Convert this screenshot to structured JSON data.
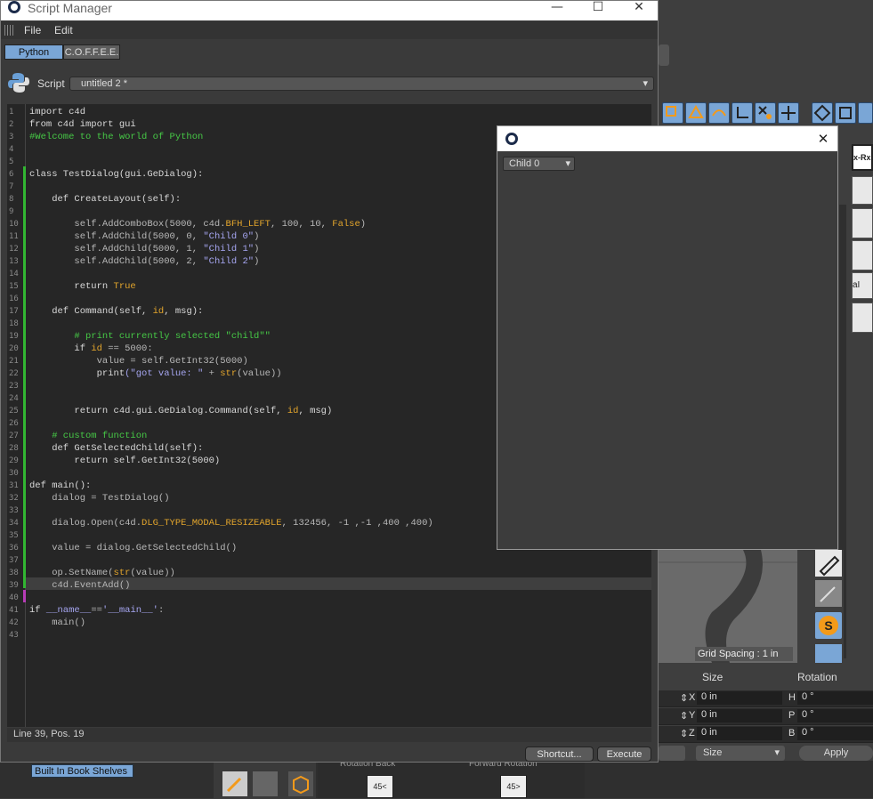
{
  "window": {
    "title": "Script Manager",
    "minimize": "—",
    "maximize": "☐",
    "close": "✕"
  },
  "menu": {
    "items": [
      "File",
      "Edit"
    ]
  },
  "language_tabs": [
    "Python",
    "C.O.F.F.E.E."
  ],
  "script_selector": {
    "label": "Script",
    "value": "untitled 2 *"
  },
  "editor": {
    "line_numbers": [
      "1",
      "2",
      "3",
      "4",
      "5",
      "6",
      "7",
      "8",
      "9",
      "10",
      "11",
      "12",
      "13",
      "14",
      "15",
      "16",
      "17",
      "18",
      "19",
      "20",
      "21",
      "22",
      "23",
      "24",
      "25",
      "26",
      "27",
      "28",
      "29",
      "30",
      "31",
      "32",
      "33",
      "34",
      "35",
      "36",
      "37",
      "38",
      "39",
      "40",
      "41",
      "42",
      "43"
    ],
    "lines": [
      [
        {
          "t": "import c4d",
          "c": "kw"
        }
      ],
      [
        {
          "t": "from c4d import gui",
          "c": "kw"
        }
      ],
      [
        {
          "t": "#Welcome to the world of Python",
          "c": "cmt"
        }
      ],
      [],
      [],
      [
        {
          "t": "class TestDialog(gui.GeDialog):",
          "c": "kw"
        }
      ],
      [],
      [
        {
          "t": "    def CreateLayout(self):",
          "c": "kw"
        }
      ],
      [],
      [
        {
          "t": "        self.AddComboBox(5000, c4d.",
          "c": "fn"
        },
        {
          "t": "BFH_LEFT",
          "c": "cst"
        },
        {
          "t": ", 100, 10, ",
          "c": "fn"
        },
        {
          "t": "False",
          "c": "cst"
        },
        {
          "t": ")",
          "c": "fn"
        }
      ],
      [
        {
          "t": "        self.AddChild(5000, 0, ",
          "c": "fn"
        },
        {
          "t": "\"Child 0\"",
          "c": "str"
        },
        {
          "t": ")",
          "c": "fn"
        }
      ],
      [
        {
          "t": "        self.AddChild(5000, 1, ",
          "c": "fn"
        },
        {
          "t": "\"Child 1\"",
          "c": "str"
        },
        {
          "t": ")",
          "c": "fn"
        }
      ],
      [
        {
          "t": "        self.AddChild(5000, 2, ",
          "c": "fn"
        },
        {
          "t": "\"Child 2\"",
          "c": "str"
        },
        {
          "t": ")",
          "c": "fn"
        }
      ],
      [],
      [
        {
          "t": "        return ",
          "c": "kw"
        },
        {
          "t": "True",
          "c": "cst"
        }
      ],
      [],
      [
        {
          "t": "    def Command(self, ",
          "c": "kw"
        },
        {
          "t": "id",
          "c": "cst"
        },
        {
          "t": ", msg):",
          "c": "kw"
        }
      ],
      [],
      [
        {
          "t": "        # print currently selected \"child\"\"",
          "c": "cmt"
        }
      ],
      [
        {
          "t": "        if ",
          "c": "kw"
        },
        {
          "t": "id",
          "c": "cst"
        },
        {
          "t": " == 5000:",
          "c": "fn"
        }
      ],
      [
        {
          "t": "            value = self.GetInt32(5000)",
          "c": "fn"
        }
      ],
      [
        {
          "t": "            print",
          "c": "kw"
        },
        {
          "t": "(\"got value: \"",
          "c": "str"
        },
        {
          "t": " + ",
          "c": "fn"
        },
        {
          "t": "str",
          "c": "cst"
        },
        {
          "t": "(value))",
          "c": "fn"
        }
      ],
      [],
      [],
      [
        {
          "t": "        return c4d.gui.GeDialog.Command(self, ",
          "c": "kw"
        },
        {
          "t": "id",
          "c": "cst"
        },
        {
          "t": ", msg)",
          "c": "kw"
        }
      ],
      [],
      [
        {
          "t": "    # custom function",
          "c": "cmt"
        }
      ],
      [
        {
          "t": "    def GetSelectedChild(self):",
          "c": "kw"
        }
      ],
      [
        {
          "t": "        return self.GetInt32(5000)",
          "c": "kw"
        }
      ],
      [],
      [
        {
          "t": "def main():",
          "c": "kw"
        }
      ],
      [
        {
          "t": "    dialog = TestDialog()",
          "c": "fn"
        }
      ],
      [],
      [
        {
          "t": "    dialog.Open(c4d.",
          "c": "fn"
        },
        {
          "t": "DLG_TYPE_MODAL_RESIZEABLE",
          "c": "cst"
        },
        {
          "t": ", 132456, -1 ,-1 ,400 ,400)",
          "c": "fn"
        }
      ],
      [],
      [
        {
          "t": "    value = dialog.GetSelectedChild()",
          "c": "fn"
        }
      ],
      [],
      [
        {
          "t": "    op.SetName(",
          "c": "fn"
        },
        {
          "t": "str",
          "c": "cst"
        },
        {
          "t": "(value))",
          "c": "fn"
        }
      ],
      [
        {
          "t": "    c4d.EventAdd()",
          "c": "fn"
        }
      ],
      [],
      [
        {
          "t": "if ",
          "c": "kw"
        },
        {
          "t": "__name__",
          "c": "str"
        },
        {
          "t": "==",
          "c": "fn"
        },
        {
          "t": "'__main__'",
          "c": "str"
        },
        {
          "t": ":",
          "c": "fn"
        }
      ],
      [
        {
          "t": "    main()",
          "c": "fn"
        }
      ],
      []
    ]
  },
  "status": {
    "text": "Line 39, Pos. 19"
  },
  "buttons": {
    "shortcut": "Shortcut...",
    "execute": "Execute"
  },
  "dialog": {
    "close": "✕",
    "combo_value": "Child 0"
  },
  "background": {
    "tag_label": "Built In Book Shelves",
    "viewport_label": "Grid Spacing : 1 in",
    "attr_headers": [
      "Size",
      "Rotation"
    ],
    "attr_rows": [
      {
        "axis1": "X",
        "v1": "0 in",
        "axis2": "H",
        "v2": "0 °"
      },
      {
        "axis1": "Y",
        "v1": "0 in",
        "axis2": "P",
        "v2": "0 °"
      },
      {
        "axis1": "Z",
        "v1": "0 in",
        "axis2": "B",
        "v2": "0 °"
      }
    ],
    "size_dropdown": "Size",
    "apply_button": "Apply",
    "side_label_1": "x-Rx",
    "side_label_2": "aI",
    "partial_labels": [
      "Rotation Back",
      "Forward Rotation"
    ]
  },
  "colors": {
    "accent": "#7aa6d6",
    "comment": "#46c846",
    "constant": "#e3a52c",
    "string": "#a5a5f0"
  }
}
